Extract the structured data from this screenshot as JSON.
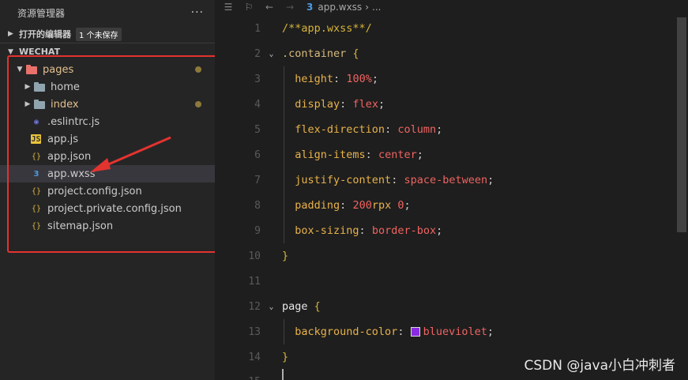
{
  "sidebar": {
    "title": "资源管理器",
    "more": "···",
    "open_editors": {
      "label": "打开的编辑器",
      "badge": "1 个未保存"
    },
    "workspace": "WECHAT",
    "tree": [
      {
        "label": "pages",
        "icon": "folder-pages-icon",
        "modified": true
      },
      {
        "label": "home",
        "icon": "folder-icon"
      },
      {
        "label": "index",
        "icon": "folder-icon",
        "modified": true
      },
      {
        "label": ".eslintrc.js",
        "icon": "eslint-icon"
      },
      {
        "label": "app.js",
        "icon": "js-file-icon"
      },
      {
        "label": "app.json",
        "icon": "json-file-icon"
      },
      {
        "label": "app.wxss",
        "icon": "css-file-icon",
        "selected": true
      },
      {
        "label": "project.config.json",
        "icon": "json-file-icon"
      },
      {
        "label": "project.private.config.json",
        "icon": "json-file-icon"
      },
      {
        "label": "sitemap.json",
        "icon": "json-file-icon"
      }
    ]
  },
  "breadcrumb": {
    "file": "app.wxss",
    "more": "..."
  },
  "code": {
    "line_numbers": [
      "1",
      "2",
      "3",
      "4",
      "5",
      "6",
      "7",
      "8",
      "9",
      "10",
      "11",
      "12",
      "13",
      "14",
      "15"
    ],
    "l1_comment": "/**app.wxss**/",
    "l2_selector": ".container",
    "l12_selector": "page",
    "open_brace": "{",
    "close_brace": "}",
    "props": {
      "height": "height",
      "height_val": "100%",
      "display": "display",
      "display_val": "flex",
      "flex_direction": "flex-direction",
      "flex_direction_val": "column",
      "align_items": "align-items",
      "align_items_val": "center",
      "justify_content": "justify-content",
      "justify_content_val": "space-between",
      "padding": "padding",
      "padding_num": "200",
      "padding_unit": "rpx",
      "padding_num2": "0",
      "box_sizing": "box-sizing",
      "box_sizing_val": "border-box",
      "bg_color": "background-color",
      "bg_color_val": "blueviolet"
    },
    "swatch_color": "#8a2be2"
  },
  "watermark": "CSDN @java小白冲刺者"
}
